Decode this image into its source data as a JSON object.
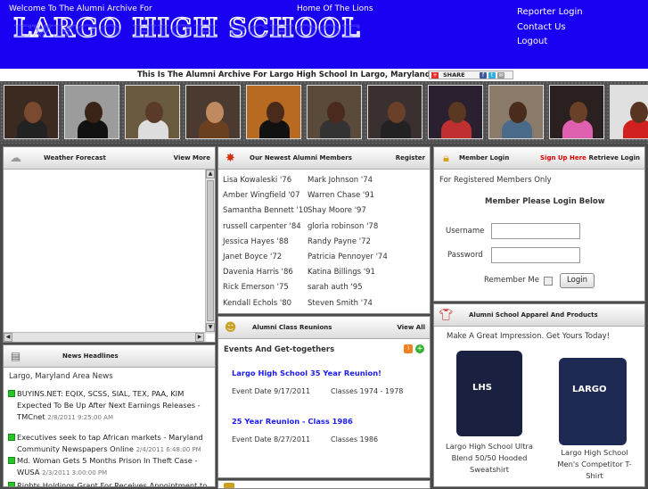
{
  "header": {
    "welcome": "Welcome To The Alumni Archive For",
    "home": "Home Of The Lions",
    "school_name": "LARGO HIGH SCHOOL",
    "links": [
      "Reporter Login",
      "Contact Us",
      "Logout"
    ]
  },
  "tagline": "This Is The Alumni Archive For Largo High School In Largo, Maryland 20772",
  "share": {
    "label": "SHARE"
  },
  "photos": [
    {
      "name": "alumni-photo-1",
      "bg": "#3a2a20",
      "face": "#7a4a30",
      "shirt": "#222"
    },
    {
      "name": "alumni-photo-2",
      "bg": "#9c9c9c",
      "face": "#3a2418",
      "shirt": "#111"
    },
    {
      "name": "alumni-photo-3",
      "bg": "#6a5a40",
      "face": "#5a3a28",
      "shirt": "#ddd"
    },
    {
      "name": "alumni-photo-4",
      "bg": "#4a3a30",
      "face": "#c08a60",
      "shirt": "#6a4020"
    },
    {
      "name": "alumni-photo-5",
      "bg": "#b86a20",
      "face": "#4a2a1a",
      "shirt": "#111"
    },
    {
      "name": "alumni-photo-6",
      "bg": "#5a4a3a",
      "face": "#4a2a1c",
      "shirt": "#333"
    },
    {
      "name": "alumni-photo-7",
      "bg": "#3a3030",
      "face": "#6a4028",
      "shirt": "#222"
    },
    {
      "name": "alumni-photo-8",
      "bg": "#2a2030",
      "face": "#5a3822",
      "shirt": "#c03030"
    },
    {
      "name": "alumni-photo-9",
      "bg": "#8a7a6a",
      "face": "#4a2c1c",
      "shirt": "#4a6a8a"
    },
    {
      "name": "alumni-photo-10",
      "bg": "#2a2020",
      "face": "#6a4028",
      "shirt": "#e060b0"
    },
    {
      "name": "alumni-photo-11",
      "bg": "#e0e0e0",
      "face": "#5a3422",
      "shirt": "#d02020"
    }
  ],
  "weather": {
    "title": "Weather Forecast",
    "more": "View More"
  },
  "news": {
    "title": "News Headlines",
    "heading": "Largo, Maryland Area News",
    "items": [
      {
        "text": "BUYINS.NET: EQIX, SCSS, SIAL, TEX, PAA, KIM Expected To Be Up After Next Earnings Releases - TMCnet",
        "date": "2/8/2011 9:25:00 AM"
      },
      {
        "text": "Executives seek to tap African markets - Maryland Community Newspapers Online",
        "date": "2/4/2011 6:48:00 PM"
      },
      {
        "text": "Md. Woman Gets 5 Months Prison In Theft Case - WUSA",
        "date": "2/3/2011 3:00:00 PM"
      },
      {
        "text": "Rights Holdings Grant For Receives Appointment to",
        "date": ""
      }
    ]
  },
  "members": {
    "title": "Our Newest Alumni Members",
    "register": "Register",
    "left": [
      "Lisa Kowaleski '76",
      "Amber Wingfield '07",
      "Samantha Bennett '10",
      "russell carpenter '84",
      "Jessica Hayes '88",
      "Janet Boyce '72",
      "Davenia Harris '86",
      "Rick Emerson '75",
      "Kendall Echols '80"
    ],
    "right": [
      "Mark Johnson '74",
      "Warren Chase '91",
      "Shay Moore '97",
      "gloria robinson '78",
      "Randy Payne '72",
      "Patricia Pennoyer '74",
      "Katina Billings '91",
      "sarah auth '95",
      "Steven Smith '74"
    ]
  },
  "reunions": {
    "title": "Alumni Class Reunions",
    "all": "View All",
    "subtitle": "Events And Get-togethers",
    "events": [
      {
        "title": "Largo High School 35 Year Reunion!",
        "date": "Event Date 9/17/2011",
        "classes": "Classes 1974 - 1978"
      },
      {
        "title": "25 Year Reunion - Class 1986",
        "date": "Event Date 8/27/2011",
        "classes": "Classes 1986"
      }
    ]
  },
  "login": {
    "title": "Member Login",
    "signup": "Sign Up Here",
    "retrieve": "Retrieve Login",
    "note": "For Registered Members Only",
    "prompt": "Member Please Login Below",
    "username_label": "Username",
    "password_label": "Password",
    "remember_label": "Remember Me",
    "button": "Login"
  },
  "apparel": {
    "title": "Alumni School Apparel And Products",
    "tagline": "Make A Great Impression. Get Yours Today!",
    "items": [
      {
        "name": "Largo High School Ultra Blend 50/50 Hooded Sweatshirt",
        "print": "LHS"
      },
      {
        "name": "Largo High School Men's Competitor T-Shirt",
        "print": "LARGO"
      }
    ]
  },
  "colors": {
    "header_blue": "#1a00f0",
    "link_blue": "#1a1aee",
    "signup_red": "#dd0000",
    "new_green": "#26c526"
  }
}
